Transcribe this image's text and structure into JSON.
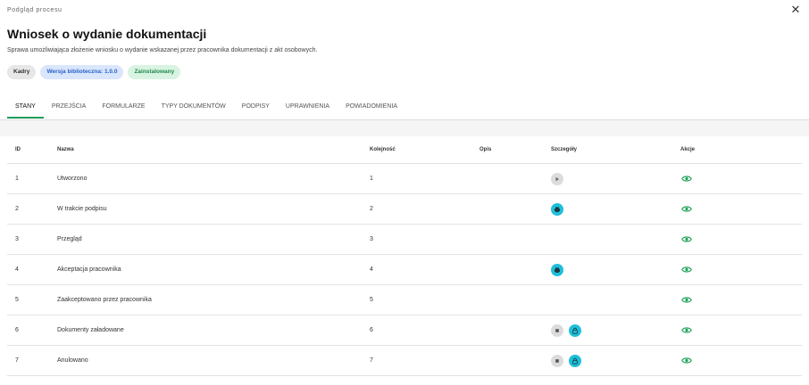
{
  "header": {
    "label": "Podgląd procesu",
    "close_icon": "close-icon"
  },
  "title": "Wniosek o wydanie dokumentacji",
  "subtitle": "Sprawa umożliwiająca złożenie wniosku o wydanie wskazanej przez pracownika dokumentacji z akt osobowych.",
  "badges": [
    "Kadry",
    "Wersja biblioteczna: 1.0.0",
    "Zainstalowany"
  ],
  "tabs": [
    "STANY",
    "PRZEJŚCIA",
    "FORMULARZE",
    "TYPY DOKUMENTÓW",
    "PODPISY",
    "UPRAWNIENIA",
    "POWIADOMIENIA"
  ],
  "active_tab": "STANY",
  "table": {
    "headers": {
      "id": "ID",
      "name": "Nazwa",
      "kolejnosc": "Kolejność",
      "opis": "Opis",
      "szczegoly": "Szczegóły",
      "akcje": "Akcje"
    },
    "rows": [
      {
        "id": "1",
        "name": "Utworzono",
        "kolejnosc": "1",
        "opis": "",
        "details": [
          "play-icon"
        ],
        "action": "eye-icon"
      },
      {
        "id": "2",
        "name": "W trakcie podpisu",
        "kolejnosc": "2",
        "opis": "",
        "details": [
          "signature-icon"
        ],
        "action": "eye-icon"
      },
      {
        "id": "3",
        "name": "Przegląd",
        "kolejnosc": "3",
        "opis": "",
        "details": [],
        "action": "eye-icon"
      },
      {
        "id": "4",
        "name": "Akceptacja pracownika",
        "kolejnosc": "4",
        "opis": "",
        "details": [
          "signature-icon"
        ],
        "action": "eye-icon"
      },
      {
        "id": "5",
        "name": "Zaakceptowano przez pracownika",
        "kolejnosc": "5",
        "opis": "",
        "details": [],
        "action": "eye-icon"
      },
      {
        "id": "6",
        "name": "Dokumenty załadowane",
        "kolejnosc": "6",
        "opis": "",
        "details": [
          "stop-icon",
          "lock-icon"
        ],
        "action": "eye-icon"
      },
      {
        "id": "7",
        "name": "Anulowano",
        "kolejnosc": "7",
        "opis": "",
        "details": [
          "stop-icon",
          "lock-icon"
        ],
        "action": "eye-icon"
      }
    ]
  },
  "colors": {
    "accent_green": "#1e9b5a",
    "cyan": "#1ebfd9",
    "grey_dot": "#dcdcdc",
    "eye_green": "#22a35a"
  }
}
